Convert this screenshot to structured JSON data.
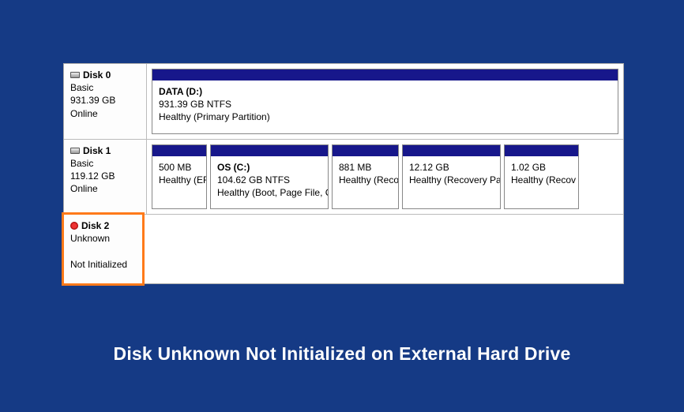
{
  "caption": "Disk Unknown Not Initialized on External Hard Drive",
  "disks": [
    {
      "name": "Disk 0",
      "type": "Basic",
      "size": "931.39 GB",
      "status": "Online",
      "error": false,
      "highlight": false,
      "volumes": [
        {
          "title": "DATA (D:)",
          "size": "931.39 GB NTFS",
          "status": "Healthy (Primary Partition)",
          "flex": 1
        }
      ]
    },
    {
      "name": "Disk 1",
      "type": "Basic",
      "size": "119.12 GB",
      "status": "Online",
      "error": false,
      "highlight": false,
      "volumes": [
        {
          "title": "",
          "size": "500 MB",
          "status": "Healthy (EFI",
          "width": 70
        },
        {
          "title": "OS  (C:)",
          "size": "104.62 GB NTFS",
          "status": "Healthy (Boot, Page File, C",
          "width": 150
        },
        {
          "title": "",
          "size": "881 MB",
          "status": "Healthy (Reco",
          "width": 85
        },
        {
          "title": "",
          "size": "12.12 GB",
          "status": "Healthy (Recovery Pa",
          "width": 125
        },
        {
          "title": "",
          "size": "1.02 GB",
          "status": "Healthy (Recov",
          "width": 95
        }
      ]
    },
    {
      "name": "Disk 2",
      "type": "Unknown",
      "size": "",
      "status": "Not Initialized",
      "error": true,
      "highlight": true,
      "volumes": []
    }
  ]
}
